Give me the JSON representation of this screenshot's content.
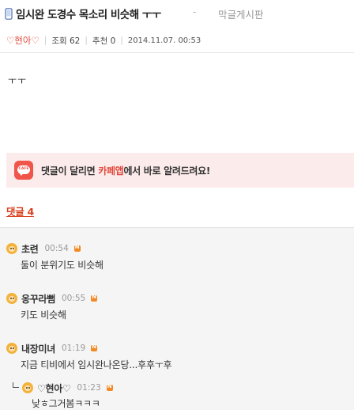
{
  "post": {
    "title": "임시완 도경수 목소리 비슷해 ㅜㅜ",
    "dash": "-",
    "board_name": "막글게시판",
    "author": "♡현아♡",
    "views_label": "조회",
    "views": "62",
    "recommend_label": "추천",
    "recommend": "0",
    "date": "2014.11.07.  00:53",
    "body": "ㅜㅜ"
  },
  "cafe_banner": {
    "icon_text": "CAFE",
    "pre": "댓글이 달리면 ",
    "accent": "카페앱",
    "post": "에서 바로 알려드려요!"
  },
  "comments_header": {
    "label": "댓글 4"
  },
  "comments": [
    {
      "name": "초련",
      "time": "00:54",
      "text": "둘이 분위기도 비슷해",
      "reply": false
    },
    {
      "name": "옹꾸라뻠",
      "time": "00:55",
      "text": "키도 비슷해",
      "reply": false
    },
    {
      "name": "내장미녀",
      "time": "01:19",
      "text": "지금 티비에서 임시완나온당...후후ㅜ후",
      "reply": false
    },
    {
      "name": "♡현아♡",
      "time": "01:23",
      "text": "낮ㅎ그거봄ㅋㅋㅋ",
      "reply": true
    }
  ],
  "colors": {
    "accent": "#e0483b",
    "comment_count": "#d9411e",
    "banner_bg": "#fcebeb",
    "comments_bg": "#f5f5f5",
    "new_badge": "#f08a24"
  }
}
